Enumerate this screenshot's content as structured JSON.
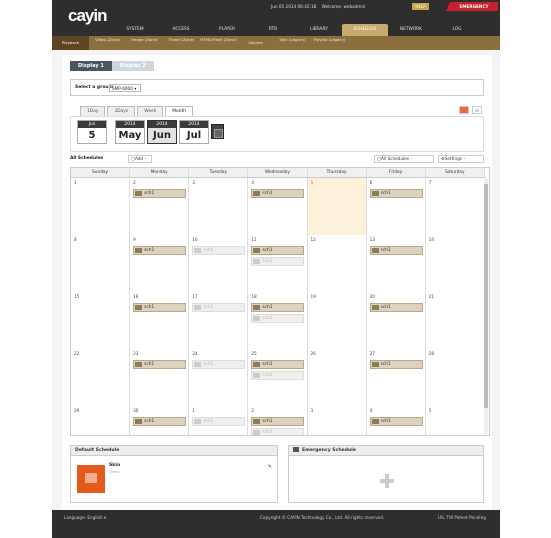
{
  "header": {
    "logo": "cayin",
    "datetime": "Jun 05 2014 06:42:18",
    "welcome": "Welcome, webadmin",
    "help": "HELP",
    "emergency": "EMERGENCY",
    "nav": [
      "SYSTEM",
      "ACCESS",
      "PLAYER",
      "RTB",
      "LIBRARY",
      "SCHEDULE",
      "NETWORK",
      "LOG"
    ],
    "active_nav": "SCHEDULE"
  },
  "subnav": [
    {
      "label": "Playback"
    },
    {
      "label": "Video (Zone)"
    },
    {
      "label": "Image (Zone)"
    },
    {
      "label": "Ticker (Zone)"
    },
    {
      "label": "HTML/Flash (Zone)"
    },
    {
      "label": "Volume"
    },
    {
      "label": "Skin (Legacy)"
    },
    {
      "label": "Playlist (Legacy)"
    }
  ],
  "display_tabs": [
    "Display 1",
    "Display 2"
  ],
  "group": {
    "label": "Select a group:",
    "value": "SMP-6000"
  },
  "view_tabs": [
    "1Day",
    "3Days",
    "Week",
    "Month"
  ],
  "active_view": "Month",
  "dates": [
    {
      "top": "Jun",
      "bottom": "5"
    },
    {
      "top": "2014",
      "bottom": "May"
    },
    {
      "top": "2014",
      "bottom": "Jun"
    },
    {
      "top": "2014",
      "bottom": "Jul"
    }
  ],
  "toolbar": {
    "all_schedules_label": "All Schedules",
    "add_label": "Add",
    "all_schedules_btn": "All Schedules",
    "settings_btn": "Settings"
  },
  "calendar": {
    "days": [
      "Sunday",
      "Monday",
      "Tuesday",
      "Wednesday",
      "Thursday",
      "Friday",
      "Saturday"
    ],
    "weeks": [
      [
        "1",
        "2",
        "3",
        "4",
        "5",
        "6",
        "7"
      ],
      [
        "8",
        "9",
        "10",
        "11",
        "12",
        "13",
        "14"
      ],
      [
        "15",
        "16",
        "17",
        "18",
        "19",
        "20",
        "21"
      ],
      [
        "22",
        "23",
        "24",
        "25",
        "26",
        "27",
        "28"
      ],
      [
        "29",
        "30",
        "1",
        "2",
        "3",
        "4",
        "5"
      ]
    ],
    "event_label": "sch1",
    "event_label_dim": "sch2"
  },
  "default_schedule": {
    "title": "Default Schedule",
    "skin_name": "Skin",
    "skin_sub": "Video"
  },
  "emergency_schedule": {
    "title": "Emergency Schedule"
  },
  "footer": {
    "language": "Language: English",
    "copyright": "Copyright © CAYIN Technology Co., Ltd. All rights reserved.",
    "patent": "US, TW Patent Pending"
  }
}
